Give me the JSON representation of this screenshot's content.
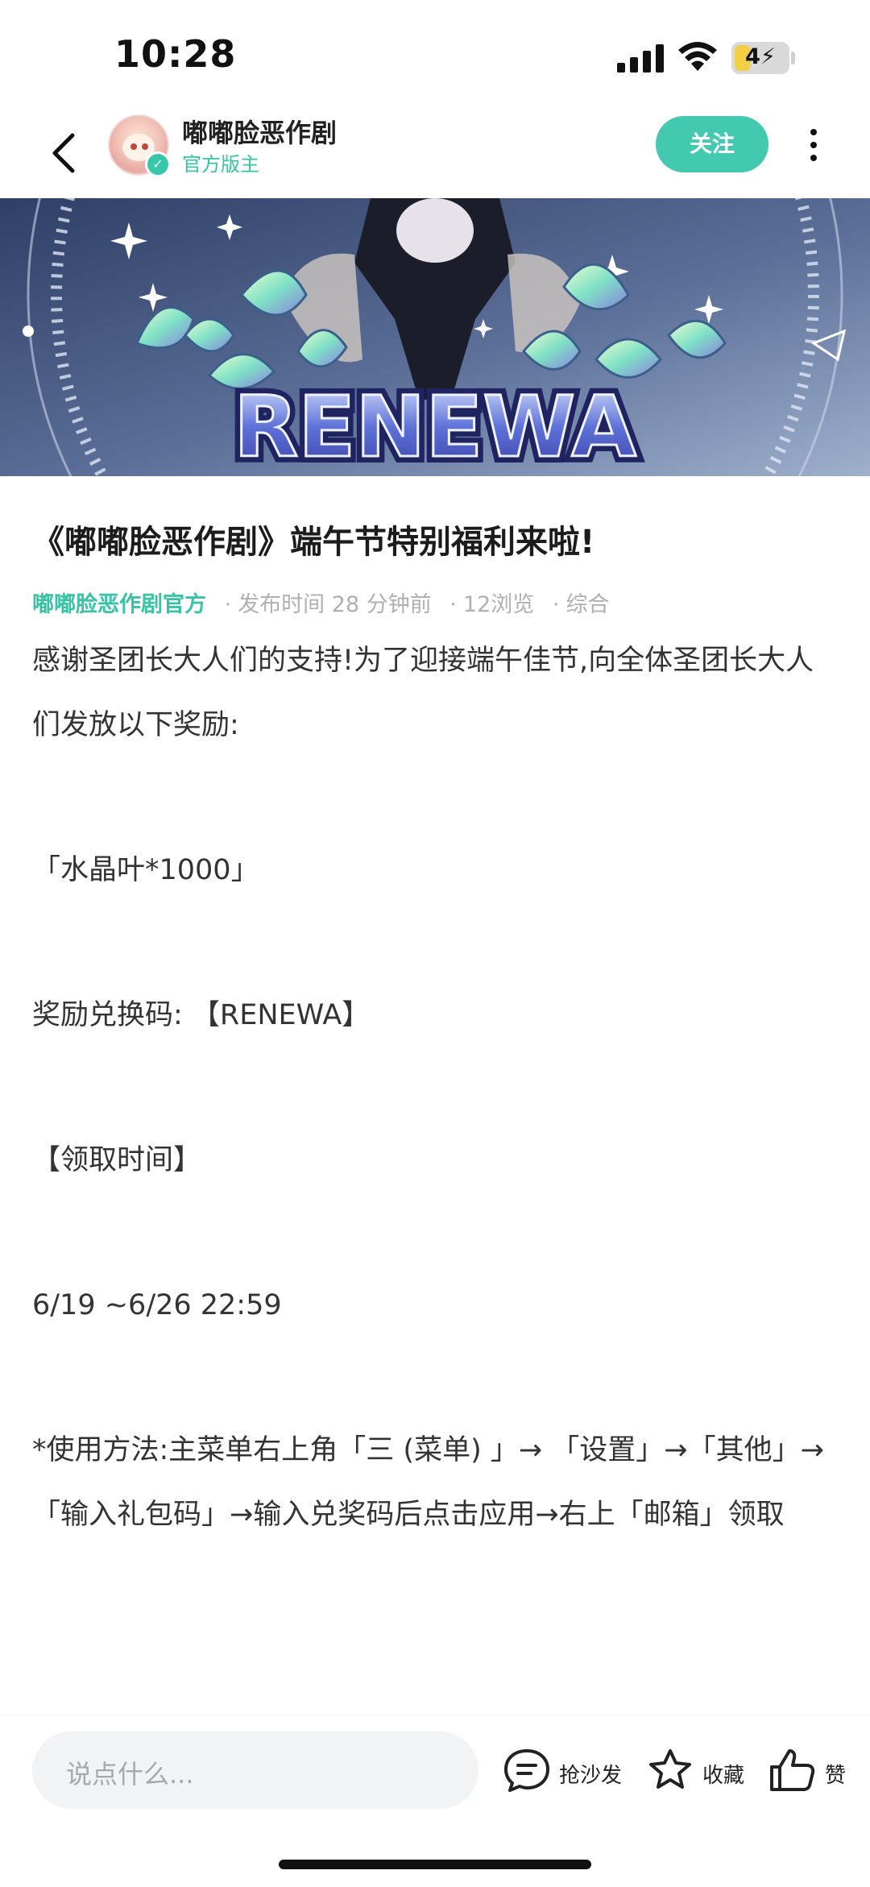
{
  "status_bar": {
    "time": "10:28",
    "battery": "4",
    "battery_bolt": "⚡"
  },
  "header": {
    "back_icon": "chevron-left-icon",
    "author_name": "嘟嘟脸恶作剧",
    "author_role": "官方版主",
    "follow_label": "关注",
    "more_icon": "vertical-ellipsis-icon"
  },
  "banner": {
    "text": "RENEWA"
  },
  "article": {
    "title": "《嘟嘟脸恶作剧》端午节特别福利来啦!",
    "meta": {
      "source": "嘟嘟脸恶作剧官方",
      "published": "发布时间 28 分钟前",
      "views": "12浏览",
      "category": "综合",
      "separator": "·"
    },
    "paragraphs": [
      "感谢圣团长大人们的支持!为了迎接端午佳节,向全体圣团长大人们发放以下奖励:",
      "「水晶叶*1000」",
      "奖励兑换码: 【RENEWA】",
      "【领取时间】",
      "6/19 ~6/26 22:59",
      "*使用方法:主菜单右上角「三 (菜单) 」→ 「设置」→「其他」→「输入礼包码」→输入兑奖码后点击应用→右上「邮箱」领取"
    ]
  },
  "bottom_bar": {
    "comment_placeholder": "说点什么...",
    "sofa_label": "抢沙发",
    "favorite_label": "收藏",
    "like_label": "赞"
  },
  "colors": {
    "accent": "#43c9b0",
    "meta_text": "#b0b0b0",
    "source_text": "#38c3a4"
  }
}
